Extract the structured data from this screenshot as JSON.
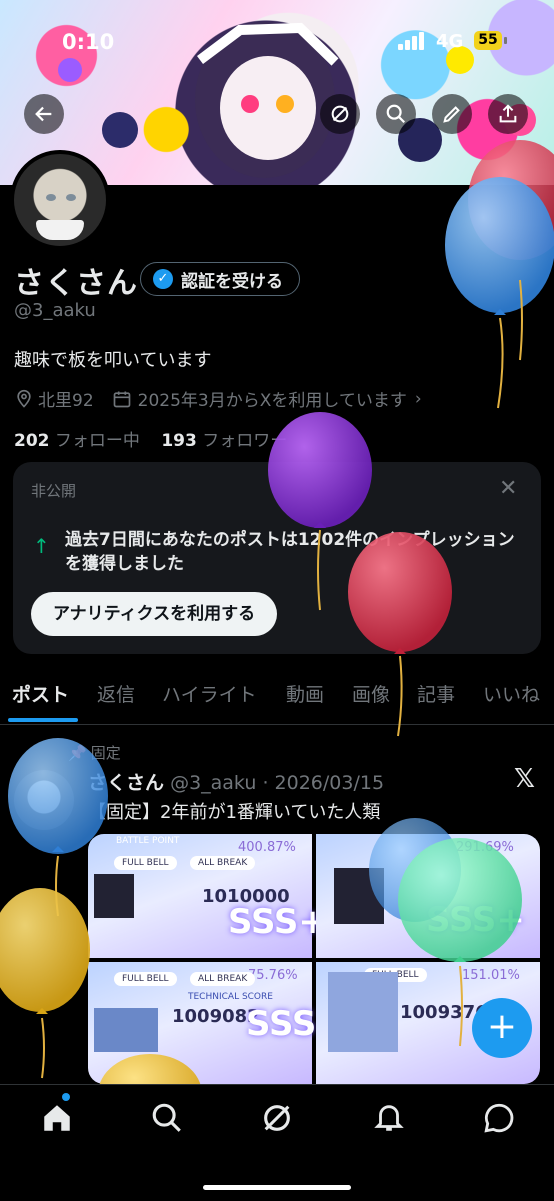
{
  "status_bar": {
    "time": "0:10",
    "network": "4G",
    "battery": "55"
  },
  "profile": {
    "name": "さくさん",
    "verify_label": "認証を受ける",
    "handle": "@3_aaku",
    "bio": "趣味で板を叩いています",
    "location": "北里92",
    "joined": "2025年3月からXを利用しています",
    "following_count": "202",
    "following_label": "フォロー中",
    "followers_count": "193",
    "followers_label": "フォロワー"
  },
  "analytics_card": {
    "private_label": "非公開",
    "message": "過去7日間にあなたのポストは1202件のインプレッションを獲得しました",
    "cta_label": "アナリティクスを利用する"
  },
  "tabs": [
    "ポスト",
    "返信",
    "ハイライト",
    "動画",
    "画像",
    "記事",
    "いいね"
  ],
  "pinned_post": {
    "pinned_label": "固定",
    "author": "さくさん",
    "handle": "@3_aaku",
    "date": "2026/03/15",
    "text": "【固定】2年前が1番輝いていた人類",
    "shots": [
      {
        "score": "1010000",
        "rank": "SSS+",
        "percent": "400.87%"
      },
      {
        "score": "",
        "rank": "SSS+",
        "percent": "291.69%"
      },
      {
        "score": "1009082",
        "rank": "SSS+",
        "percent": "75.76%"
      },
      {
        "score": "1009376",
        "rank": "",
        "percent": "151.01%"
      }
    ],
    "labels": {
      "full_bell": "FULL BELL",
      "all_break": "ALL BREAK",
      "technical_score": "TECHNICAL SCORE",
      "battle_point": "BATTLE POINT"
    }
  },
  "icons": {
    "back": "arrow-left-icon",
    "search": "search-icon",
    "share": "share-icon",
    "edit": "pen-icon",
    "nav": [
      "home-icon",
      "search-icon",
      "grok-icon",
      "bell-icon",
      "message-icon"
    ]
  },
  "colors": {
    "accent": "#1d9bf0",
    "background": "#000000",
    "card": "#16181c",
    "muted": "#71767b"
  }
}
